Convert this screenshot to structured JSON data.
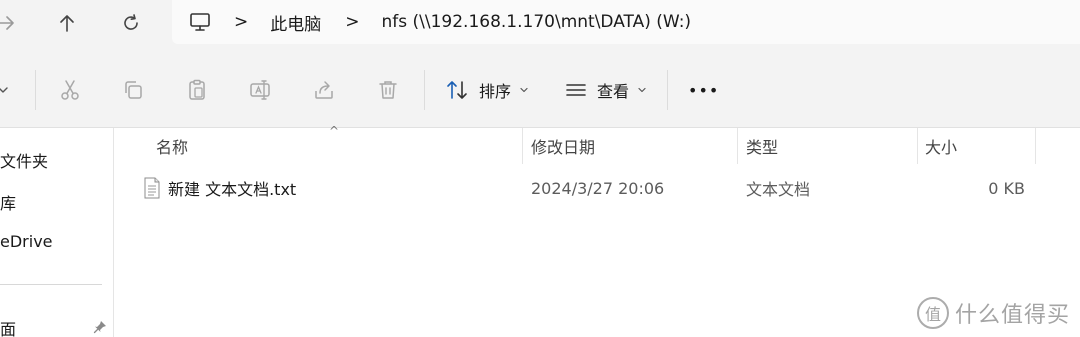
{
  "address": {
    "separator_glyph": ">",
    "crumbs": [
      {
        "label": "此电脑"
      },
      {
        "label": "nfs (\\\\192.168.1.170\\mnt\\DATA) (W:)"
      }
    ]
  },
  "toolbar": {
    "sort_label": "排序",
    "view_label": "查看",
    "more_glyph": "•••"
  },
  "sidebar": {
    "items": [
      {
        "label": "文件夹"
      },
      {
        "label": "库"
      },
      {
        "label": "eDrive"
      },
      {
        "label": "面"
      }
    ]
  },
  "columns": {
    "name": "名称",
    "modified": "修改日期",
    "type": "类型",
    "size": "大小",
    "sort_glyph": "^"
  },
  "files": [
    {
      "name": "新建 文本文档.txt",
      "modified": "2024/3/27 20:06",
      "type": "文本文档",
      "size": "0 KB"
    }
  ],
  "watermark": {
    "text": "什么值得买",
    "logo_glyph": "值"
  },
  "colors": {
    "chrome_bg": "#f3f3f3",
    "list_bg": "#ffffff",
    "disabled_icon": "#a8a8a8"
  }
}
